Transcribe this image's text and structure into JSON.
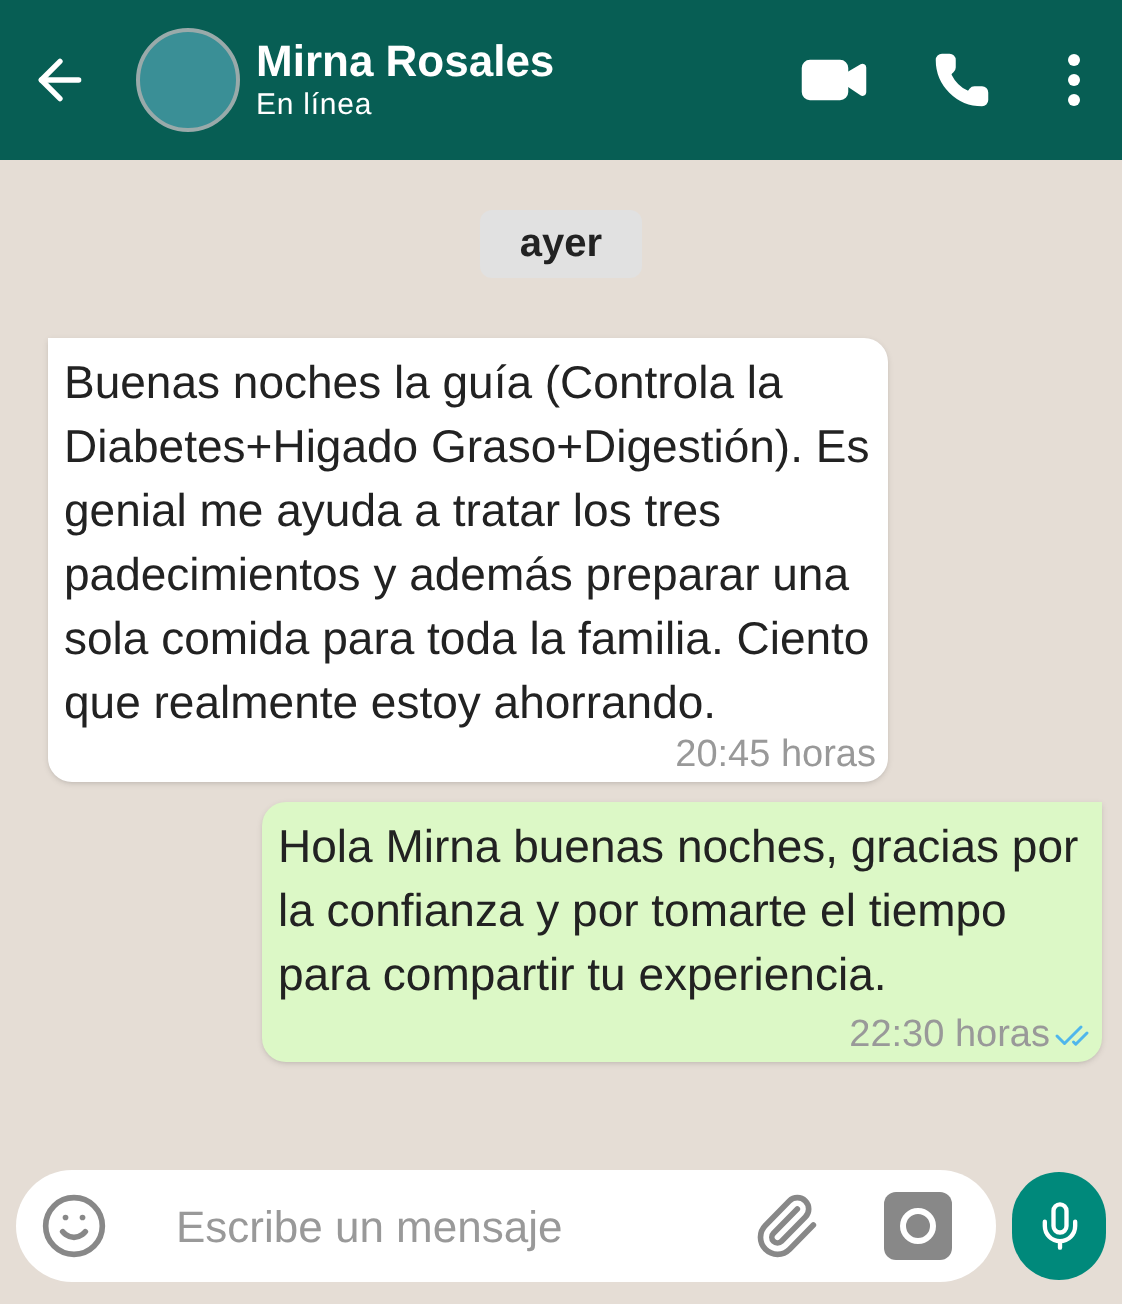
{
  "header": {
    "name": "Mirna Rosales",
    "status": "En línea"
  },
  "date_chip": "ayer",
  "messages": [
    {
      "kind": "incoming",
      "text": "Buenas noches la guía (Controla la Diabetes+Higado Graso+Digestión). Es genial me ayuda a tratar los tres padecimientos y además preparar una sola comida para toda la familia. Ciento que realmente estoy ahorrando.",
      "time": "20:45 horas"
    },
    {
      "kind": "outgoing",
      "text": "Hola Mirna buenas noches, gracias por la confianza y por tomarte el tiempo para compartir tu experiencia.",
      "time": "22:30 horas",
      "read": true
    }
  ],
  "composer": {
    "placeholder": "Escribe un mensaje"
  }
}
